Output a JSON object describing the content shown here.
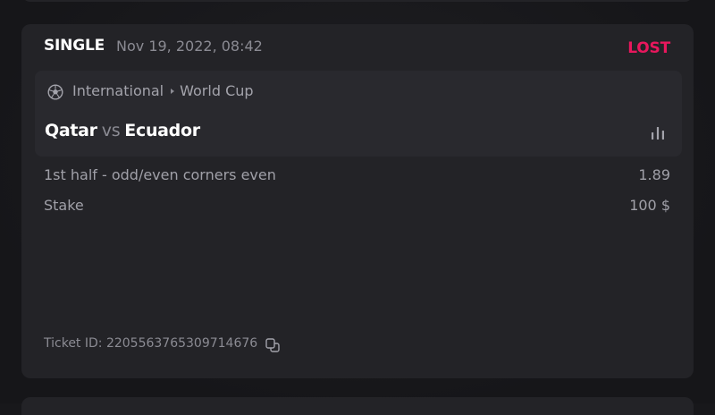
{
  "bet": {
    "type": "SINGLE",
    "date": "Nov 19, 2022, 08:42",
    "status": "LOST"
  },
  "event": {
    "sport_icon": "soccer-ball-icon",
    "category": "International",
    "league": "World Cup",
    "home_team": "Qatar",
    "vs": "vs",
    "away_team": "Ecuador",
    "stats_icon": "bar-chart-icon"
  },
  "selection": {
    "market": "1st half - odd/even corners even",
    "odds": "1.89"
  },
  "stake": {
    "label": "Stake",
    "value": "100 $"
  },
  "ticket": {
    "text": "Ticket ID: 2205563765309714676",
    "copy_icon": "copy-icon"
  },
  "colors": {
    "background": "#18181b",
    "card": "#232327",
    "event_box": "#29292e",
    "status_lost": "#e8175d",
    "muted_text": "#8b8b93"
  }
}
